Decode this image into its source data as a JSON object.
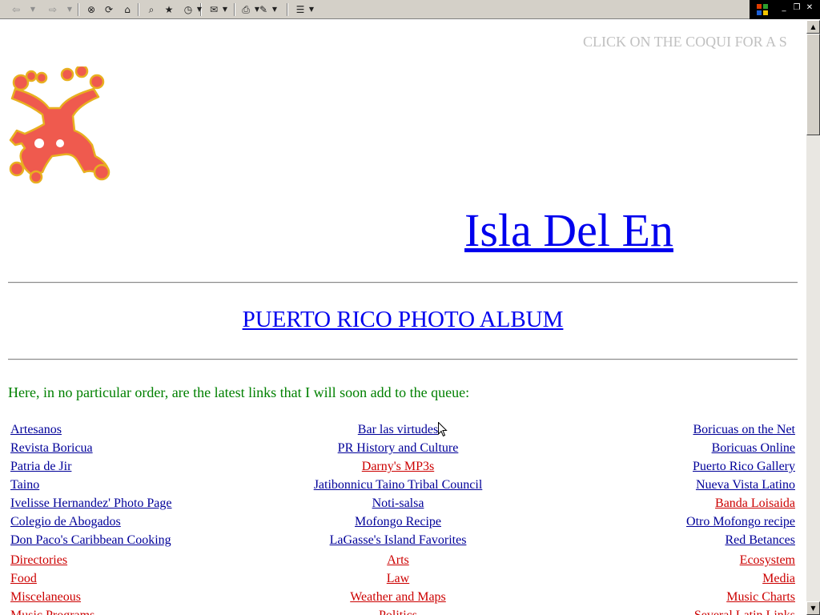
{
  "toolbar": {
    "buttons": [
      {
        "name": "back-button",
        "glyph": "⇦",
        "disabled": true
      },
      {
        "name": "back-dropdown",
        "glyph": "▼",
        "disabled": true
      },
      {
        "name": "forward-button",
        "glyph": "⇨",
        "disabled": true
      },
      {
        "name": "forward-dropdown",
        "glyph": "▼",
        "disabled": true
      },
      {
        "name": "stop-button",
        "glyph": "⊗"
      },
      {
        "name": "refresh-button",
        "glyph": "⟳"
      },
      {
        "name": "home-button",
        "glyph": "⌂"
      },
      {
        "name": "search-button",
        "glyph": "⌕"
      },
      {
        "name": "favorites-button",
        "glyph": "★"
      },
      {
        "name": "history-button",
        "glyph": "◷"
      },
      {
        "name": "mail-button",
        "glyph": "✉"
      },
      {
        "name": "print-button",
        "glyph": "⎙"
      },
      {
        "name": "edit-button",
        "glyph": "✎"
      },
      {
        "name": "messenger-button",
        "glyph": "☰"
      }
    ]
  },
  "page": {
    "marquee_text": "CLICK ON THE COQUI FOR A S",
    "title": "Isla Del En",
    "photo_album": "PUERTO RICO PHOTO ALBUM",
    "intro": "Here, in no particular order, are the latest links that I will soon add to the queue:"
  },
  "link_rows": [
    [
      "Artesanos",
      "Bar las virtudes",
      "Boricuas on the Net"
    ],
    [
      "Revista Boricua",
      "PR History and Culture",
      "Boricuas Online"
    ],
    [
      "Patria de Jir",
      "Darny's MP3s",
      "Puerto Rico Gallery"
    ],
    [
      "Taino",
      "Jatibonnicu Taino Tribal Council",
      "Nueva Vista Latino"
    ],
    [
      "Ivelisse Hernandez' Photo Page",
      "Noti-salsa",
      "Banda Loisaida"
    ],
    [
      "Colegio de Abogados",
      "Mofongo Recipe",
      "Otro Mofongo recipe"
    ],
    [
      "Don Paco's Caribbean Cooking",
      "LaGasse's Island Favorites",
      "Red Betances"
    ]
  ],
  "red_links": [
    "Darny's MP3s",
    "Banda Loisaida"
  ],
  "category_rows": [
    [
      "Directories",
      "Arts",
      "Ecosystem"
    ],
    [
      "Food",
      "Law",
      "Media"
    ],
    [
      "Miscelaneous",
      "Weather and Maps",
      "Music Charts"
    ],
    [
      "Music Programs",
      "Politics",
      "Several Latin Links"
    ]
  ],
  "colors": {
    "link_blue": "#000099",
    "link_red": "#cc0000",
    "title_blue": "#0000ee",
    "intro_green": "#008000",
    "marquee_gray": "#c0c0c0"
  }
}
